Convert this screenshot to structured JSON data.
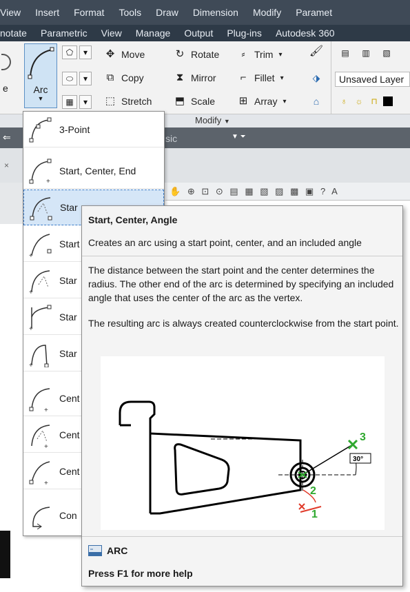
{
  "menubar": [
    "View",
    "Insert",
    "Format",
    "Tools",
    "Draw",
    "Dimension",
    "Modify",
    "Paramet"
  ],
  "ribbon_tabs": [
    "notate",
    "Parametric",
    "View",
    "Manage",
    "Output",
    "Plug-ins",
    "Autodesk 360"
  ],
  "ribbon": {
    "arc_label": "Arc",
    "move": "Move",
    "copy": "Copy",
    "stretch": "Stretch",
    "rotate": "Rotate",
    "mirror": "Mirror",
    "scale": "Scale",
    "trim": "Trim",
    "fillet": "Fillet",
    "array": "Array",
    "panel_label": "Modify",
    "layer": "Unsaved Layer",
    "left_letter": "e",
    "partial_text": "sic"
  },
  "dropdown": {
    "items": [
      "3-Point",
      "Start, Center, End",
      "Star",
      "Start",
      "Star",
      "Star",
      "Star",
      "Cent",
      "Cent",
      "Cent",
      "Con"
    ]
  },
  "tooltip": {
    "title": "Start, Center, Angle",
    "summary": "Creates an arc using a start point, center, and an included angle",
    "para1": "The distance between the start point and the center determines the radius. The other end of the arc is determined by specifying an included angle that uses the center of the arc as the vertex.",
    "para2": "The resulting arc is always created counterclockwise from the start point.",
    "diagram": {
      "angle_label": "30°",
      "point_labels": [
        "1",
        "2",
        "3"
      ]
    },
    "command": "ARC",
    "help": "Press F1 for more help"
  },
  "colors": {
    "menubar": "#3f4a57",
    "tabbar": "#2e3a47",
    "selection": "#d5e6f7",
    "point_green": "#2ea82e",
    "arc_red": "#e03a2a"
  }
}
